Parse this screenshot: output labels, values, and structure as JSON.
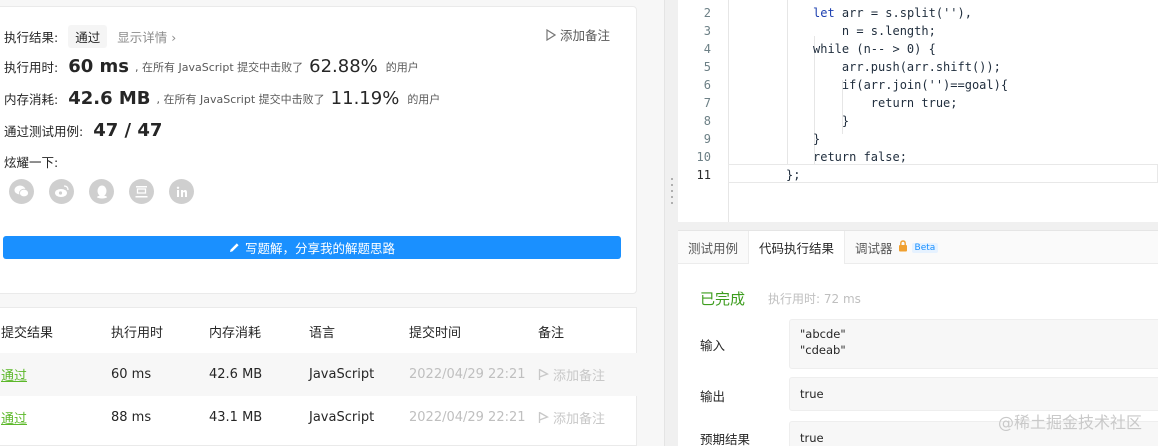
{
  "result": {
    "status_label": "执行结果:",
    "status_value": "通过",
    "detail_link": "显示详情 ›",
    "add_note": "添加备注",
    "runtime_label": "执行用时:",
    "runtime_value": "60 ms",
    "runtime_text": ", 在所有 JavaScript 提交中击败了",
    "runtime_pct": "62.88%",
    "runtime_suffix": "的用户",
    "memory_label": "内存消耗:",
    "memory_value": "42.6 MB",
    "memory_text": ", 在所有 JavaScript 提交中击败了",
    "memory_pct": "11.19%",
    "memory_suffix": "的用户",
    "cases_label": "通过测试用例:",
    "cases_value": "47 / 47",
    "share_label": "炫耀一下:",
    "share_icons": [
      "wechat-icon",
      "weibo-icon",
      "qq-icon",
      "douban-icon",
      "linkedin-icon"
    ],
    "write_button": "写题解，分享我的解题思路"
  },
  "submissions": {
    "headers": [
      "提交结果",
      "执行用时",
      "内存消耗",
      "语言",
      "提交时间",
      "备注"
    ],
    "rows": [
      {
        "status": "通过",
        "runtime": "60 ms",
        "memory": "42.6 MB",
        "lang": "JavaScript",
        "time": "2022/04/29 22:21",
        "note": "添加备注"
      },
      {
        "status": "通过",
        "runtime": "88 ms",
        "memory": "43.1 MB",
        "lang": "JavaScript",
        "time": "2022/04/29 22:21",
        "note": "添加备注"
      }
    ]
  },
  "editor": {
    "line_numbers": [
      "2",
      "3",
      "4",
      "5",
      "6",
      "7",
      "8",
      "9",
      "10",
      "11"
    ],
    "lines": [
      "let arr = s.split(''),",
      "    n = s.length;",
      "while (n-- > 0) {",
      "    arr.push(arr.shift());",
      "    if(arr.join('')==goal){",
      "        return true;",
      "    }",
      "}",
      "return false;",
      "};"
    ]
  },
  "console": {
    "tabs": [
      "测试用例",
      "代码执行结果",
      "调试器"
    ],
    "beta": "Beta",
    "done": "已完成",
    "runtime": "执行用时: 72 ms",
    "input_label": "输入",
    "input_lines": [
      "\"abcde\"",
      "\"cdeab\""
    ],
    "output_label": "输出",
    "output_value": "true",
    "expected_label": "预期结果",
    "expected_value": "true"
  },
  "watermark": "@稀土掘金技术社区"
}
